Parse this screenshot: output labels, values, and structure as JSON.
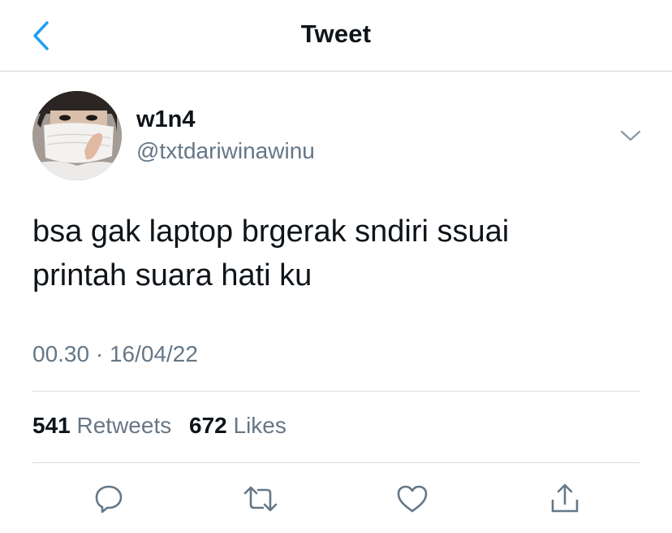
{
  "header": {
    "title": "Tweet",
    "back_icon": "chevron-left-icon",
    "accent_color": "#1da1f2"
  },
  "author": {
    "display_name": "w1n4",
    "handle": "@txtdariwinawinu",
    "more_icon": "chevron-down-icon"
  },
  "tweet": {
    "text_line1": "bsa gak laptop brgerak sndiri ssuai",
    "text_line2": "printah suara hati ku",
    "timestamp": "00.30 · 16/04/22"
  },
  "stats": {
    "retweets_count": "541",
    "retweets_label": "Retweets",
    "likes_count": "672",
    "likes_label": "Likes"
  },
  "actions": [
    {
      "name": "reply",
      "icon": "reply-icon"
    },
    {
      "name": "retweet",
      "icon": "retweet-icon"
    },
    {
      "name": "like",
      "icon": "heart-icon"
    },
    {
      "name": "share",
      "icon": "share-icon"
    }
  ],
  "colors": {
    "text_primary": "#0f1419",
    "text_secondary": "#657786",
    "divider": "#d7dbde",
    "icon_gray": "#657786"
  }
}
